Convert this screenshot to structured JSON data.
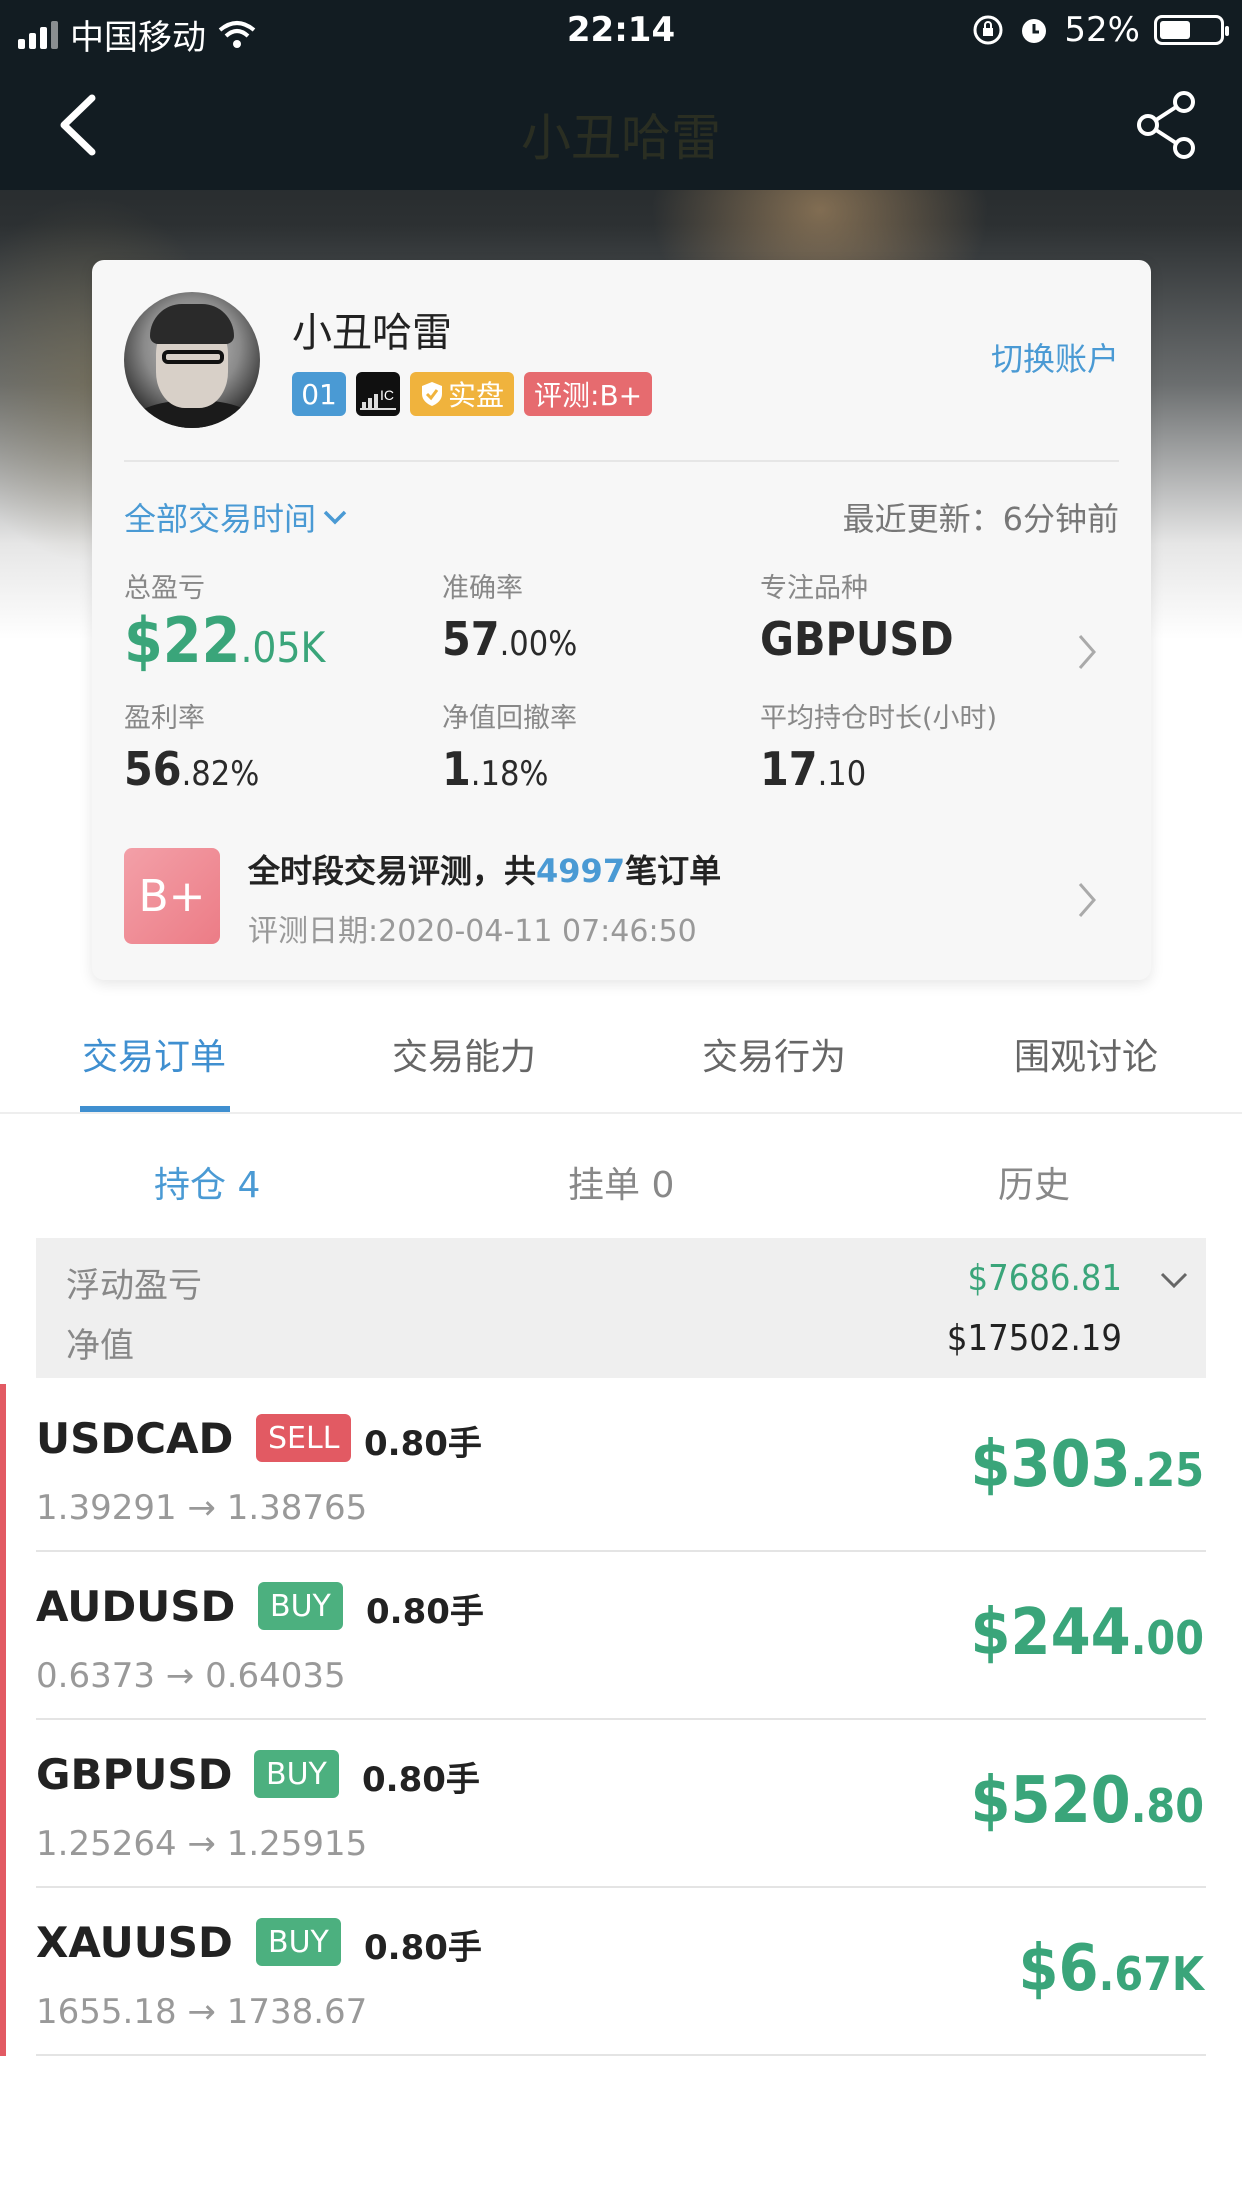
{
  "status_bar": {
    "carrier": "中国移动",
    "time": "22:14",
    "battery": "52%",
    "battery_level": 0.52
  },
  "nav": {
    "title": "小丑哈雷",
    "back_icon": "chevron-left-icon",
    "share_icon": "share-icon"
  },
  "profile": {
    "name": "小丑哈雷",
    "badges": {
      "level": "01",
      "broker": "IC",
      "live": "实盘",
      "rating": "评测:B+"
    },
    "switch_account": "切换账户",
    "time_filter": "全部交易时间",
    "last_update": "最近更新：6分钟前",
    "stats": {
      "total_pnl_label": "总盈亏",
      "total_pnl_main": "$22",
      "total_pnl_sub": ".05K",
      "accuracy_label": "准确率",
      "accuracy_main": "57",
      "accuracy_sub": ".00%",
      "focus_label": "专注品种",
      "focus_value": "GBPUSD",
      "profit_rate_label": "盈利率",
      "profit_rate_main": "56",
      "profit_rate_sub": ".82%",
      "drawdown_label": "净值回撤率",
      "drawdown_main": "1",
      "drawdown_sub": ".18%",
      "avg_hold_label": "平均持仓时长(小时)",
      "avg_hold_main": "17",
      "avg_hold_sub": ".10"
    },
    "evaluation": {
      "grade": "B+",
      "title_prefix": "全时段交易评测，共",
      "order_count": "4997",
      "title_suffix": "笔订单",
      "date": "评测日期:2020-04-11 07:46:50"
    }
  },
  "tabs": [
    "交易订单",
    "交易能力",
    "交易行为",
    "围观讨论"
  ],
  "subtabs": [
    "持仓 4",
    "挂单 0",
    "历史"
  ],
  "summary": {
    "floating_pnl_label": "浮动盈亏",
    "floating_pnl_value": "$7686.81",
    "equity_label": "净值",
    "equity_value": "$17502.19"
  },
  "positions": [
    {
      "symbol": "USDCAD",
      "side": "SELL",
      "lots": "0.80手",
      "prices": "1.39291 → 1.38765",
      "pnl_main": "$303",
      "pnl_sub": ".25"
    },
    {
      "symbol": "AUDUSD",
      "side": "BUY",
      "lots": "0.80手",
      "prices": "0.6373 → 0.64035",
      "pnl_main": "$244",
      "pnl_sub": ".00"
    },
    {
      "symbol": "GBPUSD",
      "side": "BUY",
      "lots": "0.80手",
      "prices": "1.25264 → 1.25915",
      "pnl_main": "$520",
      "pnl_sub": ".80"
    },
    {
      "symbol": "XAUUSD",
      "side": "BUY",
      "lots": "0.80手",
      "prices": "1655.18 → 1738.67",
      "pnl_main": "$6",
      "pnl_sub": ".67K"
    }
  ],
  "colors": {
    "accent_blue": "#4a9ad4",
    "profit_green": "#3aa57a",
    "sell_red": "#e25a63",
    "buy_green": "#4cb07f"
  }
}
